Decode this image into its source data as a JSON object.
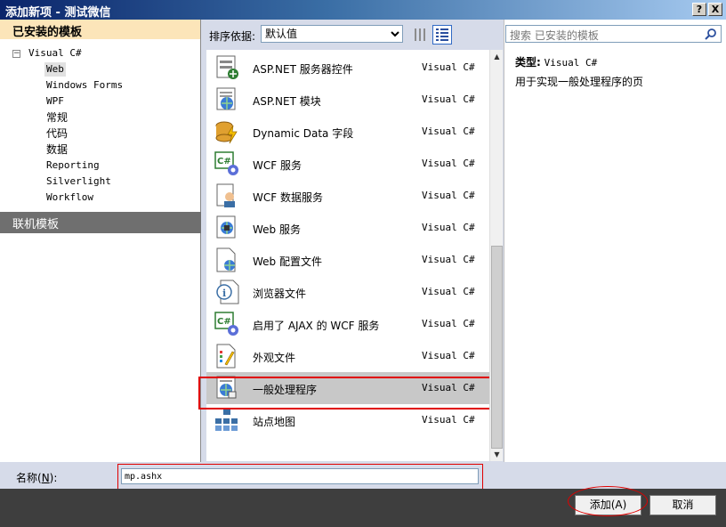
{
  "window": {
    "title": "添加新项 - 测试微信",
    "help": "?",
    "close": "X"
  },
  "left": {
    "header": "已安装的模板",
    "tree": {
      "root": "Visual C#",
      "children": [
        "Web",
        "Windows Forms",
        "WPF",
        "常规",
        "代码",
        "数据",
        "Reporting",
        "Silverlight",
        "Workflow"
      ],
      "selected": "Web"
    },
    "online": "联机模板"
  },
  "sort": {
    "label": "排序依据:",
    "value": "默认值"
  },
  "search": {
    "placeholder": "搜索 已安装的模板"
  },
  "items": [
    {
      "name": "ASP.NET 服务器控件",
      "lang": "Visual C#",
      "icon": "server-control-icon"
    },
    {
      "name": "ASP.NET 模块",
      "lang": "Visual C#",
      "icon": "module-icon"
    },
    {
      "name": "Dynamic Data 字段",
      "lang": "Visual C#",
      "icon": "dynamic-data-icon"
    },
    {
      "name": "WCF 服务",
      "lang": "Visual C#",
      "icon": "wcf-service-icon"
    },
    {
      "name": "WCF 数据服务",
      "lang": "Visual C#",
      "icon": "wcf-data-service-icon"
    },
    {
      "name": "Web 服务",
      "lang": "Visual C#",
      "icon": "web-service-icon"
    },
    {
      "name": "Web 配置文件",
      "lang": "Visual C#",
      "icon": "web-config-icon"
    },
    {
      "name": "浏览器文件",
      "lang": "Visual C#",
      "icon": "browser-file-icon"
    },
    {
      "name": "启用了 AJAX 的 WCF 服务",
      "lang": "Visual C#",
      "icon": "ajax-wcf-icon"
    },
    {
      "name": "外观文件",
      "lang": "Visual C#",
      "icon": "skin-file-icon"
    },
    {
      "name": "一般处理程序",
      "lang": "Visual C#",
      "icon": "generic-handler-icon"
    },
    {
      "name": "站点地图",
      "lang": "Visual C#",
      "icon": "sitemap-icon"
    }
  ],
  "selected_item": "一般处理程序",
  "details": {
    "type_label": "类型:",
    "type_value": "Visual C#",
    "description": "用于实现一般处理程序的页"
  },
  "name_field": {
    "label_prefix": "名称(",
    "label_key": "N",
    "label_suffix": "):",
    "value": "mp.ashx"
  },
  "buttons": {
    "add": "添加(A)",
    "cancel": "取消"
  },
  "colors": {
    "highlight": "#e00000",
    "header_bg": "#fce5b9",
    "online_bg": "#6f6f6f"
  }
}
